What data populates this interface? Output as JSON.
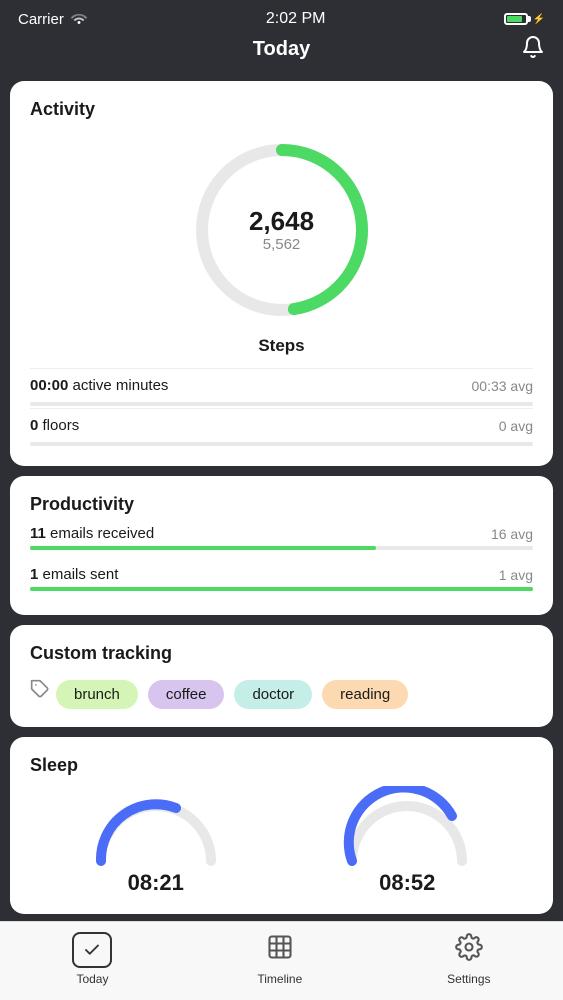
{
  "statusBar": {
    "carrier": "Carrier",
    "time": "2:02 PM"
  },
  "header": {
    "title": "Today"
  },
  "activity": {
    "cardTitle": "Activity",
    "stepsLabel": "Steps",
    "stepsCurrent": "2,648",
    "stepsGoal": "5,562",
    "stepsProgress": 47.6,
    "activeMinutes": {
      "label": "active minutes",
      "current": "00:00",
      "avg": "00:33 avg"
    },
    "floors": {
      "label": "floors",
      "current": "0",
      "avg": "0 avg"
    }
  },
  "productivity": {
    "cardTitle": "Productivity",
    "emailsReceived": {
      "count": "11",
      "label": "emails received",
      "avg": "16 avg",
      "progress": 68.75
    },
    "emailsSent": {
      "count": "1",
      "label": "emails sent",
      "avg": "1 avg",
      "progress": 100
    }
  },
  "customTracking": {
    "cardTitle": "Custom tracking",
    "tags": [
      {
        "label": "brunch",
        "colorClass": "tag-brunch"
      },
      {
        "label": "coffee",
        "colorClass": "tag-coffee"
      },
      {
        "label": "doctor",
        "colorClass": "tag-doctor"
      },
      {
        "label": "reading",
        "colorClass": "tag-reading"
      }
    ]
  },
  "sleep": {
    "cardTitle": "Sleep",
    "chart1Time": "08:21",
    "chart2Time": "08:52"
  },
  "bottomNav": {
    "items": [
      {
        "label": "Today",
        "icon": "check",
        "active": true
      },
      {
        "label": "Timeline",
        "icon": "calendar",
        "active": false
      },
      {
        "label": "Settings",
        "icon": "gear",
        "active": false
      }
    ]
  }
}
